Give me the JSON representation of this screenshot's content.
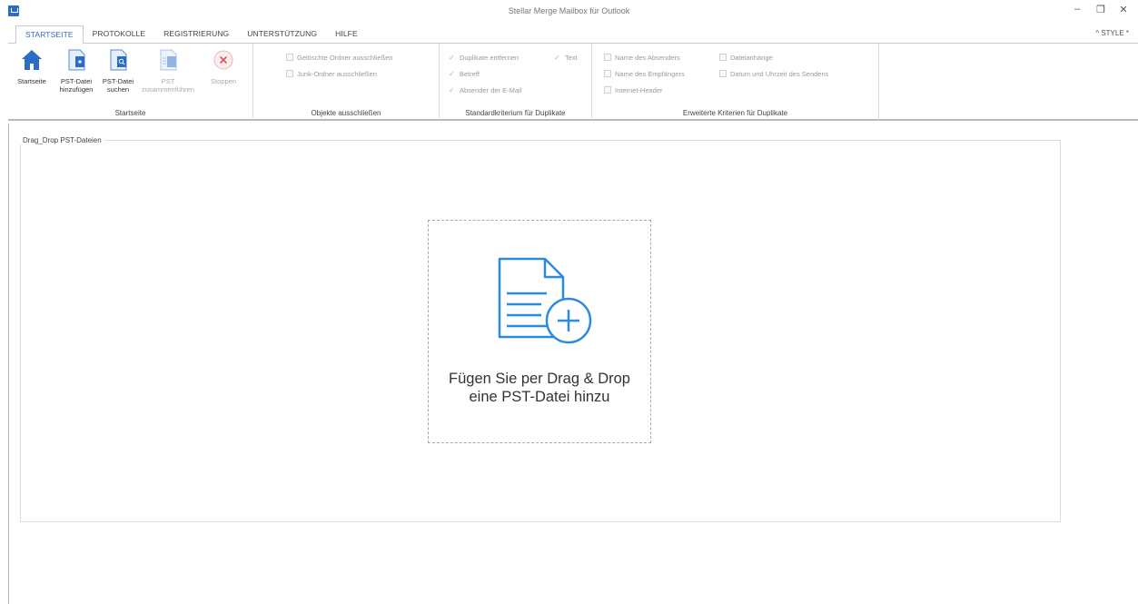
{
  "window": {
    "title": "Stellar Merge Mailbox für Outlook"
  },
  "window_controls": {
    "minimize": "–",
    "maximize": "❐",
    "close": "✕"
  },
  "tabs": [
    "STARTSEITE",
    "PROTOKOLLE",
    "REGISTRIERUNG",
    "UNTERSTÜTZUNG",
    "HILFE"
  ],
  "style_button": "^ STYLE *",
  "ribbon": {
    "startseite_group": {
      "label": "Startseite",
      "buttons": {
        "home": {
          "line1": "Startseite",
          "line2": "",
          "icon": "home-icon"
        },
        "add_pst": {
          "line1": "PST-Datei",
          "line2": "hinzufügen",
          "icon": "add-pst-file-icon"
        },
        "search_pst": {
          "line1": "PST-Datei",
          "line2": "suchen",
          "icon": "search-pst-file-icon"
        },
        "merge_pst": {
          "line1": "PST",
          "line2": "zusammenführen",
          "icon": "merge-pst-icon"
        },
        "stop": {
          "line1": "Stoppen",
          "line2": "",
          "icon": "stop-icon"
        }
      }
    },
    "exclude_group": {
      "label": "Objekte ausschließen",
      "options": [
        "Gelöschte Ordner ausschließen",
        "Junk-Ordner ausschließen"
      ]
    },
    "standard_group": {
      "label": "Standardkriterium für Duplikate",
      "options": [
        "Duplikate entfernen",
        "Text",
        "Betreff",
        "Absender der E-Mail"
      ]
    },
    "advanced_group": {
      "label": "Erweiterte Kriterien für Duplikate",
      "options": [
        "Name des Absenders",
        "Dateianhänge",
        "Name des Empfängers",
        "Datum und Uhrzeit des Sendens",
        "Internet-Header"
      ]
    }
  },
  "main": {
    "legend": "Drag_Drop PST-Dateien",
    "drop_line1": "Fügen Sie per Drag & Drop",
    "drop_line2": "eine PST-Datei hinzu"
  },
  "colors": {
    "accent": "#2b6cc4",
    "drop_icon": "#2b8be0",
    "disabled": "#a8a8a8"
  }
}
